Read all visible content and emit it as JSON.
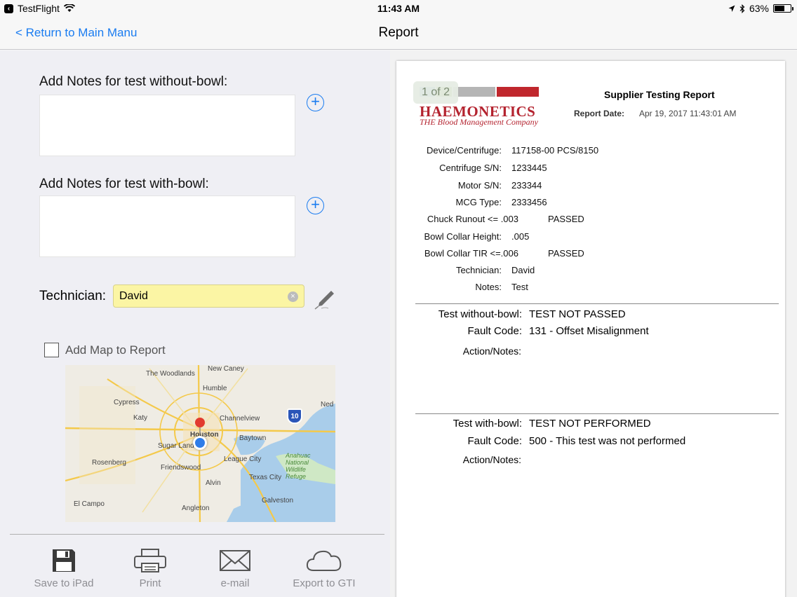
{
  "status_bar": {
    "app": "TestFlight",
    "time": "11:43 AM",
    "battery": "63%",
    "battery_level": 0.63,
    "icons": [
      "back-chip-icon",
      "wifi-icon",
      "location-arrow-icon",
      "bluetooth-icon",
      "battery-icon"
    ]
  },
  "nav": {
    "back_label": "< Return to Main Manu",
    "title": "Report"
  },
  "form": {
    "notes_without_bowl_label": "Add Notes for test without-bowl:",
    "notes_with_bowl_label": "Add Notes for test with-bowl:",
    "notes_without_bowl_value": "",
    "notes_with_bowl_value": "",
    "technician_label": "Technician:",
    "technician_value": "David",
    "add_map_label": "Add Map to Report",
    "add_map_checked": false
  },
  "map": {
    "labels": [
      "New Caney",
      "The Woodlands",
      "Humble",
      "Cypress",
      "Katy",
      "Channelview",
      "Ned",
      "Houston",
      "Baytown",
      "Sugar Land",
      "Rosenberg",
      "Friendswood",
      "League City",
      "Anahuac National Wildlife Refuge",
      "Alvin",
      "Texas City",
      "Galveston",
      "El Campo",
      "Angleton"
    ],
    "highway_shield": "10"
  },
  "toolbar": {
    "items": [
      {
        "label": "Save to iPad",
        "icon": "floppy-disk-icon"
      },
      {
        "label": "Print",
        "icon": "printer-icon"
      },
      {
        "label": "e-mail",
        "icon": "envelope-icon"
      },
      {
        "label": "Export to GTI",
        "icon": "cloud-icon"
      }
    ]
  },
  "report": {
    "page_indicator": "1 of 2",
    "logo_word": "HAEMONETICS",
    "logo_tagline": "THE Blood Management Company",
    "logo_colors": [
      "#7fb2d8",
      "#8cb63c",
      "#b5b5b5",
      "#c0272d"
    ],
    "title": "Supplier Testing Report",
    "date_label": "Report Date:",
    "date_value": "Apr 19, 2017  11:43:01 AM",
    "fields": [
      {
        "label": "Device/Centrifuge:",
        "value": "117158-00 PCS/8150"
      },
      {
        "label": "Centrifuge S/N:",
        "value": "1233445"
      },
      {
        "label": "Motor S/N:",
        "value": "233344"
      },
      {
        "label": "MCG Type:",
        "value": "2333456"
      },
      {
        "label": "Chuck Runout <= .003",
        "value": "PASSED"
      },
      {
        "label": "Bowl Collar Height:",
        "value": ".005"
      },
      {
        "label": "Bowl Collar TIR <=.006",
        "value": "PASSED"
      },
      {
        "label": "Technician:",
        "value": "David"
      },
      {
        "label": "Notes:",
        "value": "Test"
      }
    ],
    "without_bowl": {
      "result_label": "Test without-bowl:",
      "result_value": "TEST NOT PASSED",
      "fault_label": "Fault Code:",
      "fault_value": "131 - Offset Misalignment",
      "action_label": "Action/Notes:",
      "action_value": ""
    },
    "with_bowl": {
      "result_label": "Test with-bowl:",
      "result_value": "TEST NOT PERFORMED",
      "fault_label": "Fault Code:",
      "fault_value": "500 - This test was not performed",
      "action_label": "Action/Notes:",
      "action_value": ""
    }
  },
  "colors": {
    "accent": "#1a7cf0",
    "technician_field_bg": "#fbf5a4",
    "brand_red": "#b4232f"
  }
}
